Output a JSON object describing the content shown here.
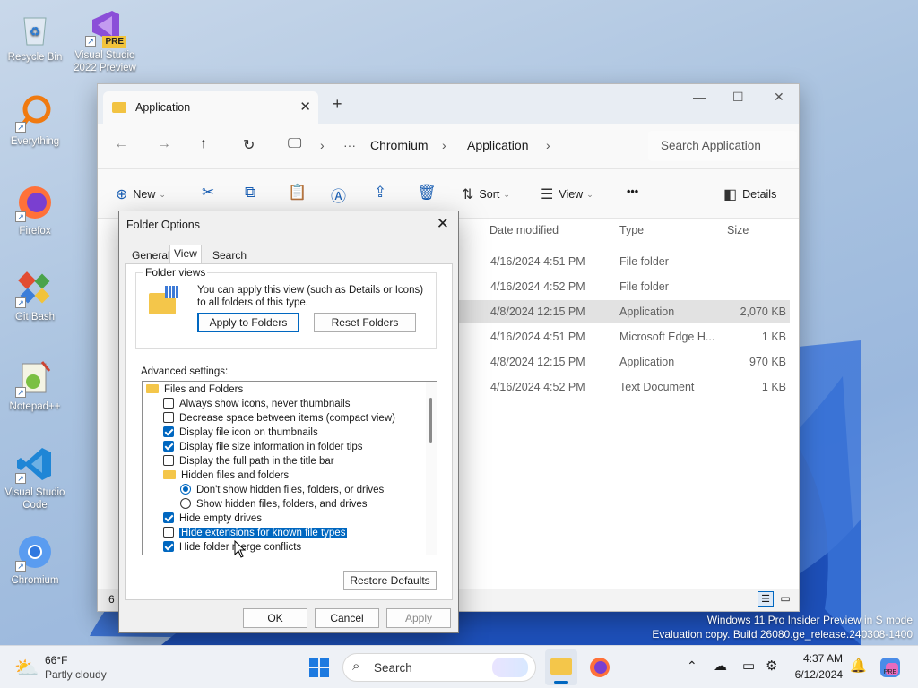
{
  "desktop": {
    "icons": [
      {
        "label": "Recycle Bin"
      },
      {
        "label": "Visual Studio 2022 Preview",
        "badge": "PRE"
      },
      {
        "label": "Everything"
      },
      {
        "label": "Firefox"
      },
      {
        "label": "Git Bash"
      },
      {
        "label": "Notepad++"
      },
      {
        "label": "Visual Studio Code"
      },
      {
        "label": "Chromium"
      }
    ],
    "watermark": {
      "line1": "Windows 11 Pro Insider Preview in S mode",
      "line2": "Evaluation copy. Build 26080.ge_release.240308-1400"
    }
  },
  "explorer": {
    "tab_title": "Application",
    "new_tab": "+",
    "breadcrumb": [
      "Chromium",
      "Application"
    ],
    "search_placeholder": "Search Application",
    "commands": {
      "new": "New",
      "sort": "Sort",
      "view": "View",
      "more": "•••",
      "details": "Details"
    },
    "columns": {
      "date": "Date modified",
      "type": "Type",
      "size": "Size"
    },
    "rows": [
      {
        "date": "4/16/2024 4:51 PM",
        "type": "File folder",
        "size": ""
      },
      {
        "date": "4/16/2024 4:52 PM",
        "type": "File folder",
        "size": ""
      },
      {
        "date": "4/8/2024 12:15 PM",
        "type": "Application",
        "size": "2,070 KB"
      },
      {
        "date": "4/16/2024 4:51 PM",
        "type": "Microsoft Edge H...",
        "size": "1 KB"
      },
      {
        "date": "4/8/2024 12:15 PM",
        "type": "Application",
        "size": "970 KB"
      },
      {
        "date": "4/16/2024 4:52 PM",
        "type": "Text Document",
        "size": "1 KB"
      }
    ],
    "status_count": "6"
  },
  "dialog": {
    "title": "Folder Options",
    "tabs": [
      "General",
      "View",
      "Search"
    ],
    "folder_views_label": "Folder views",
    "folder_views_text": "You can apply this view (such as Details or Icons) to all folders of this type.",
    "apply_to_folders": "Apply to Folders",
    "reset_folders": "Reset Folders",
    "advanced_label": "Advanced settings:",
    "tree": [
      {
        "kind": "folder",
        "label": "Files and Folders",
        "indent": 0
      },
      {
        "kind": "check",
        "checked": false,
        "label": "Always show icons, never thumbnails",
        "indent": 1
      },
      {
        "kind": "check",
        "checked": false,
        "label": "Decrease space between items (compact view)",
        "indent": 1
      },
      {
        "kind": "check",
        "checked": true,
        "label": "Display file icon on thumbnails",
        "indent": 1
      },
      {
        "kind": "check",
        "checked": true,
        "label": "Display file size information in folder tips",
        "indent": 1
      },
      {
        "kind": "check",
        "checked": false,
        "label": "Display the full path in the title bar",
        "indent": 1
      },
      {
        "kind": "folder",
        "label": "Hidden files and folders",
        "indent": 1
      },
      {
        "kind": "radio",
        "checked": true,
        "label": "Don't show hidden files, folders, or drives",
        "indent": 2
      },
      {
        "kind": "radio",
        "checked": false,
        "label": "Show hidden files, folders, and drives",
        "indent": 2
      },
      {
        "kind": "check",
        "checked": true,
        "label": "Hide empty drives",
        "indent": 1
      },
      {
        "kind": "check",
        "checked": false,
        "label": "Hide extensions for known file types",
        "indent": 1,
        "highlight": true
      },
      {
        "kind": "check",
        "checked": true,
        "label": "Hide folder merge conflicts",
        "indent": 1
      }
    ],
    "restore_defaults": "Restore Defaults",
    "ok": "OK",
    "cancel": "Cancel",
    "apply": "Apply"
  },
  "taskbar": {
    "weather_temp": "66°F",
    "weather_desc": "Partly cloudy",
    "search_label": "Search",
    "time": "4:37 AM",
    "date": "6/12/2024"
  },
  "colors": {
    "accent": "#0067c0",
    "folder": "#f4c64a"
  }
}
